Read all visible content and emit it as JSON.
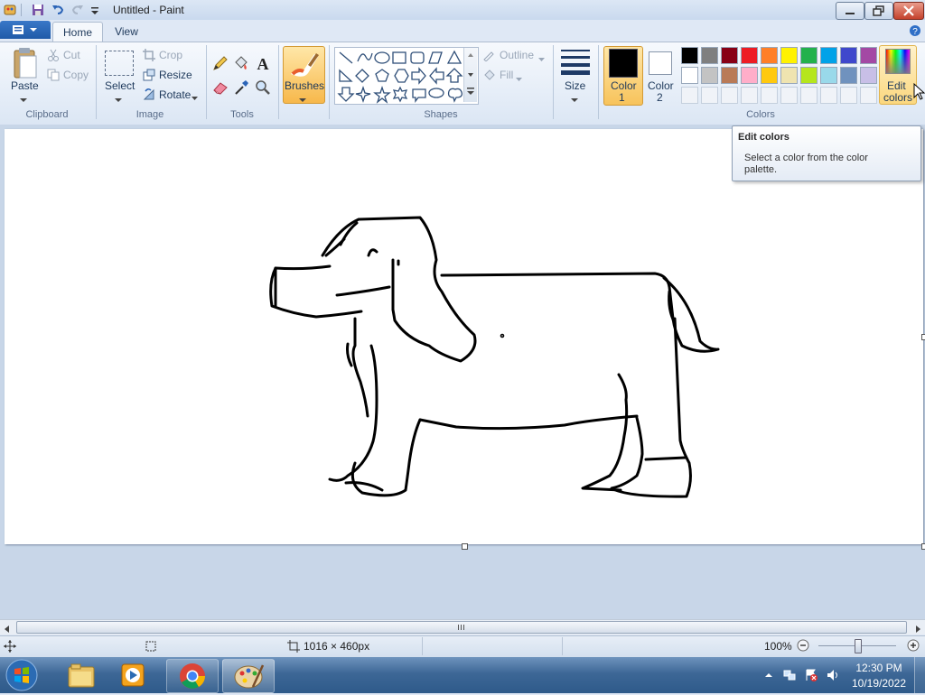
{
  "window": {
    "title": "Untitled - Paint"
  },
  "tabs": [
    {
      "label": "Home"
    },
    {
      "label": "View"
    }
  ],
  "clipboard": {
    "paste": "Paste",
    "cut": "Cut",
    "copy": "Copy",
    "group": "Clipboard"
  },
  "image": {
    "select": "Select",
    "crop": "Crop",
    "resize": "Resize",
    "rotate": "Rotate",
    "group": "Image"
  },
  "tools": {
    "group": "Tools"
  },
  "brushes": {
    "label": "Brushes"
  },
  "shapes": {
    "outline": "Outline",
    "fill": "Fill",
    "group": "Shapes"
  },
  "size": {
    "label": "Size"
  },
  "colors": {
    "color1": {
      "label": "Color",
      "num": "1",
      "value": "#000000"
    },
    "color2": {
      "label": "Color",
      "num": "2",
      "value": "#ffffff"
    },
    "edit_label": "Edit",
    "edit_label2": "colors",
    "group": "Colors",
    "palette_row1": [
      "#000000",
      "#7f7f7f",
      "#880015",
      "#ed1c24",
      "#ff7f27",
      "#fff200",
      "#22b14c",
      "#00a2e8",
      "#3f48cc",
      "#a349a4"
    ],
    "palette_row2": [
      "#ffffff",
      "#c3c3c3",
      "#b97a57",
      "#ffaec9",
      "#ffc90e",
      "#efe4b0",
      "#b5e61d",
      "#99d9ea",
      "#7092be",
      "#c8bfe7"
    ]
  },
  "tooltip": {
    "title": "Edit colors",
    "line1": "Select a color from the color",
    "line2": "palette."
  },
  "status": {
    "canvas_size": "1016 × 460px",
    "zoom": "100%"
  },
  "clock": {
    "time": "12:30 PM",
    "date": "10/19/2022"
  }
}
